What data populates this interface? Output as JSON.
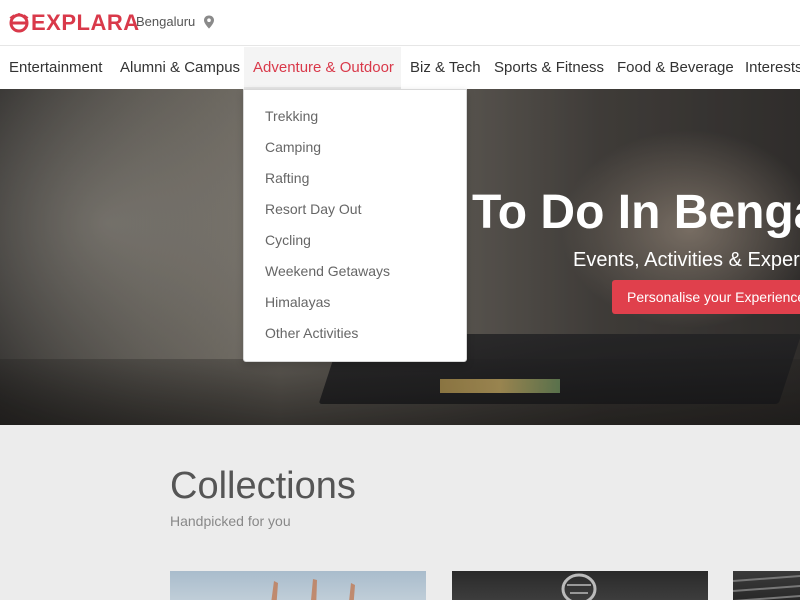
{
  "brand": {
    "name": "EXPLARA",
    "color": "#d9394a"
  },
  "location": {
    "city": "Bengaluru",
    "icon": "map-pin-icon"
  },
  "nav": {
    "items": [
      {
        "label": "Entertainment"
      },
      {
        "label": "Alumni & Campus"
      },
      {
        "label": "Adventure & Outdoor",
        "active": true
      },
      {
        "label": "Biz & Tech"
      },
      {
        "label": "Sports & Fitness"
      },
      {
        "label": "Food & Beverage"
      },
      {
        "label": "Interests"
      }
    ]
  },
  "dropdown": {
    "items": [
      "Trekking",
      "Camping",
      "Rafting",
      "Resort Day Out",
      "Cycling",
      "Weekend Getaways",
      "Himalayas",
      "Other Activities"
    ]
  },
  "hero": {
    "title": "To Do In Bengaluru",
    "subtitle": "Events, Activities & Experiences",
    "button_label": "Personalise your Experience"
  },
  "collections": {
    "title": "Collections",
    "subtitle": "Handpicked for you"
  },
  "colors": {
    "accent": "#e0404c",
    "active_nav": "#d9394a"
  }
}
